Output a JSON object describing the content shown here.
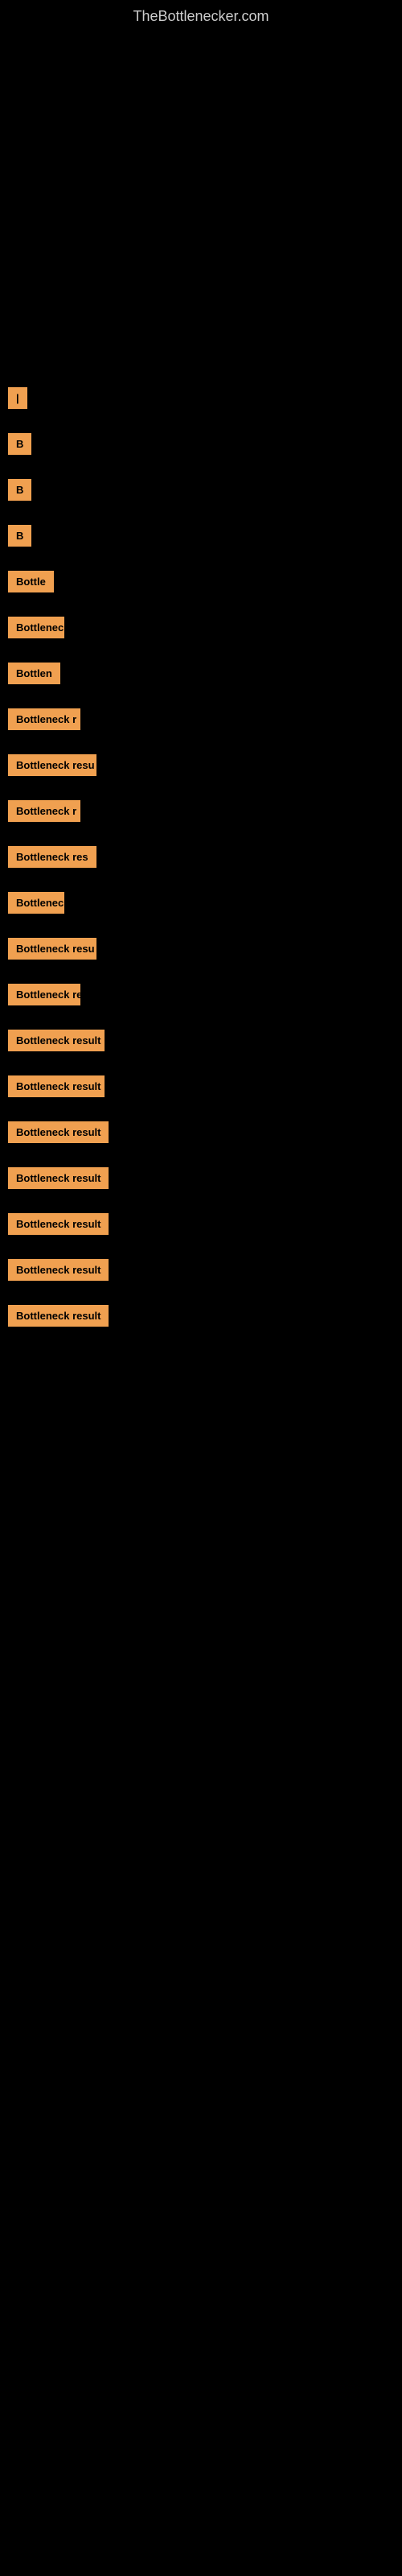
{
  "site": {
    "title": "TheBottlenecker.com"
  },
  "items": [
    {
      "id": 1,
      "label": "|",
      "widthClass": "w-tiny",
      "itemClass": "item-1"
    },
    {
      "id": 2,
      "label": "B",
      "widthClass": "w-tiny",
      "itemClass": "item-2"
    },
    {
      "id": 3,
      "label": "B",
      "widthClass": "w-tiny",
      "itemClass": "item-3"
    },
    {
      "id": 4,
      "label": "B",
      "widthClass": "w-tiny",
      "itemClass": "item-4"
    },
    {
      "id": 5,
      "label": "Bottle",
      "widthClass": "w-small",
      "itemClass": "item-5"
    },
    {
      "id": 6,
      "label": "Bottleneck",
      "widthClass": "w-small2",
      "itemClass": "item-6"
    },
    {
      "id": 7,
      "label": "Bottlen",
      "widthClass": "w-small2",
      "itemClass": "item-7"
    },
    {
      "id": 8,
      "label": "Bottleneck r",
      "widthClass": "w-med1",
      "itemClass": "item-8"
    },
    {
      "id": 9,
      "label": "Bottleneck resu",
      "widthClass": "w-med2",
      "itemClass": "item-9"
    },
    {
      "id": 10,
      "label": "Bottleneck r",
      "widthClass": "w-med1",
      "itemClass": "item-10"
    },
    {
      "id": 11,
      "label": "Bottleneck res",
      "widthClass": "w-med2",
      "itemClass": "item-11"
    },
    {
      "id": 12,
      "label": "Bottleneck",
      "widthClass": "w-small2",
      "itemClass": "item-12"
    },
    {
      "id": 13,
      "label": "Bottleneck resu",
      "widthClass": "w-med2",
      "itemClass": "item-13"
    },
    {
      "id": 14,
      "label": "Bottleneck re",
      "widthClass": "w-med1",
      "itemClass": "item-14"
    },
    {
      "id": 15,
      "label": "Bottleneck result",
      "widthClass": "w-med3",
      "itemClass": "item-15"
    },
    {
      "id": 16,
      "label": "Bottleneck result",
      "widthClass": "w-med3",
      "itemClass": "item-16"
    },
    {
      "id": 17,
      "label": "Bottleneck result",
      "widthClass": "w-med4",
      "itemClass": "item-17"
    },
    {
      "id": 18,
      "label": "Bottleneck result",
      "widthClass": "w-med4",
      "itemClass": "item-18"
    },
    {
      "id": 19,
      "label": "Bottleneck result",
      "widthClass": "w-large",
      "itemClass": "item-19"
    },
    {
      "id": 20,
      "label": "Bottleneck result",
      "widthClass": "w-large",
      "itemClass": "item-20"
    },
    {
      "id": 21,
      "label": "Bottleneck result",
      "widthClass": "w-full",
      "itemClass": "item-21"
    }
  ]
}
